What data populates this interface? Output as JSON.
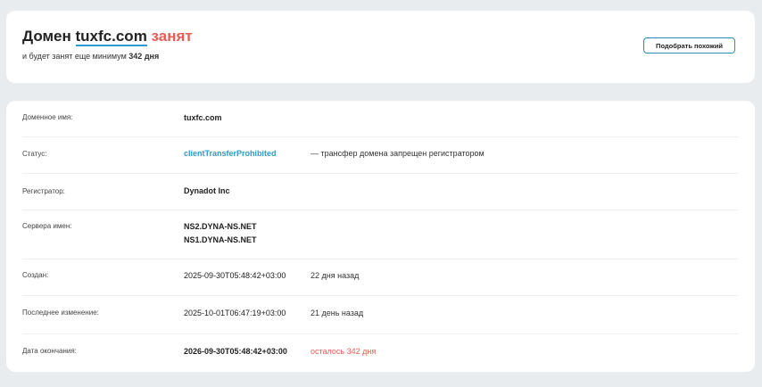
{
  "header": {
    "title_prefix": "Домен",
    "domain": "tuxfc.com",
    "status_word": "занят",
    "subtitle_prefix": "и будет занят еще минимум",
    "subtitle_days": "342 дня",
    "similar_button": "Подобрать похожий"
  },
  "accent_color": "#2d9bd2",
  "busy_color": "#e65b54",
  "rows": [
    {
      "label": "Доменное имя:",
      "value": "tuxfc.com"
    },
    {
      "label": "Статус:",
      "value": "clientTransferProhibited",
      "note": "— трансфер домена запрещен регистратором"
    },
    {
      "label": "Регистратор:",
      "value": "Dynadot Inc"
    },
    {
      "label": "Сервера имен:",
      "values": [
        "NS2.DYNA-NS.NET",
        "NS1.DYNA-NS.NET"
      ]
    },
    {
      "label": "Создан:",
      "value": "2025-09-30T05:48:42+03:00",
      "note": "22 дня назад"
    },
    {
      "label": "Последнее изменение:",
      "value": "2025-10-01T06:47:19+03:00",
      "note": "21 день назад"
    },
    {
      "label": "Дата окончания:",
      "value": "2026-09-30T05:48:42+03:00",
      "note": "осталось 342 дня"
    }
  ]
}
